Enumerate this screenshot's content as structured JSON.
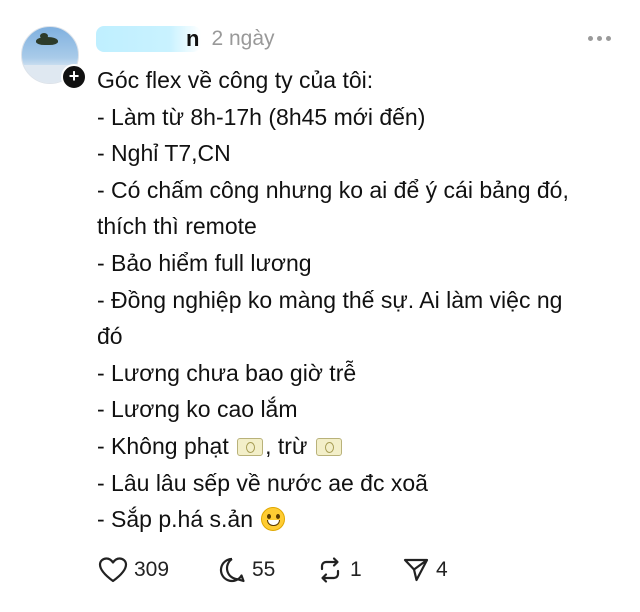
{
  "post": {
    "author_name": "n",
    "time": "2 ngày",
    "lines": [
      "Góc flex về công ty của tôi:",
      "- Làm từ 8h-17h (8h45 mới đến)",
      "- Nghỉ T7,CN",
      "- Có chấm công nhưng ko ai để ý cái bảng đó,",
      "thích thì remote",
      "- Bảo hiểm full lương",
      "- Đồng nghiệp ko màng thế sự. Ai làm việc ng",
      "đó",
      "- Lương chưa bao giờ trễ",
      "- Lương ko cao lắm",
      "- Không phạt",
      ", trừ",
      "- Lâu lâu sếp về nước ae đc xoã",
      "- Sắp p.há s.ản"
    ],
    "emoji": [
      "money-icon",
      "money-icon",
      "grinning-face-icon"
    ]
  },
  "actions": {
    "likes": "309",
    "replies": "55",
    "reposts": "1",
    "shares": "4"
  }
}
